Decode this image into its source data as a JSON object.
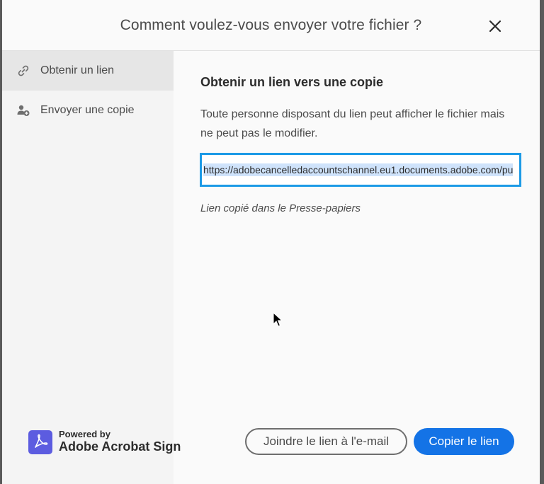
{
  "dialog": {
    "title": "Comment voulez-vous envoyer votre fichier ?",
    "close_icon": "close-icon"
  },
  "sidebar": {
    "items": [
      {
        "label": "Obtenir un lien",
        "icon": "link-icon",
        "active": true
      },
      {
        "label": "Envoyer une copie",
        "icon": "add-person-icon",
        "active": false
      }
    ],
    "brand": {
      "powered_by": "Powered by",
      "name": "Adobe Acrobat Sign",
      "icon": "acrobat-logo-icon"
    }
  },
  "main": {
    "heading": "Obtenir un lien vers une copie",
    "description": "Toute personne disposant du lien peut afficher le fichier mais ne peut pas le modifier.",
    "link_value": "https://adobecancelledaccountschannel.eu1.documents.adobe.com/pu",
    "copied_message": "Lien copié dans le Presse-papiers"
  },
  "buttons": {
    "attach_label": "Joindre le lien à l'e-mail",
    "copy_label": "Copier le lien"
  },
  "colors": {
    "accent": "#1473e6",
    "input_focus": "#1c9ae6",
    "brand": "#5c5ce0"
  }
}
